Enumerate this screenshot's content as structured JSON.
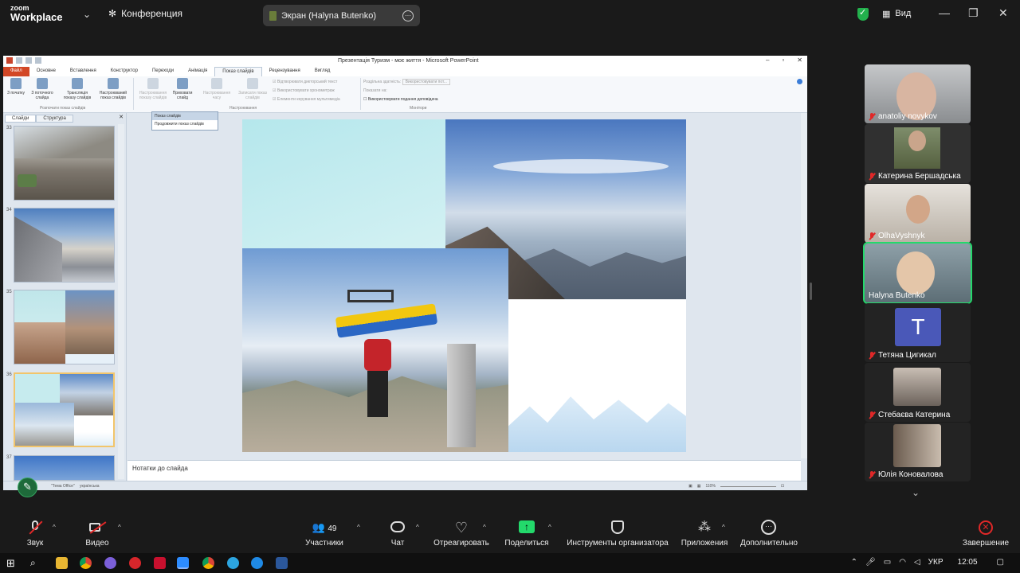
{
  "zoom": {
    "logo_small": "zoom",
    "logo_big": "Workplace",
    "meeting_label": "Конференция",
    "screen_share_label": "Экран (Halyna Butenko)",
    "view_label": "Вид"
  },
  "ppt": {
    "window_title": "Презентація Туризм - моє життя - Microsoft PowerPoint",
    "tabs": [
      "Файл",
      "Основне",
      "Вставлення",
      "Конструктор",
      "Переходи",
      "Анімація",
      "Показ слайдів",
      "Рецензування",
      "Вигляд"
    ],
    "active_tab_index": 6,
    "ribbon": {
      "from_start": "З початку",
      "from_current": "З поточного слайда",
      "broadcast": "Трансляція показу слайдів",
      "custom_show": "Настроюваний показ слайдів",
      "group_start": "Розпочати показ слайдів",
      "setup_show": "Настроювання показу слайдів",
      "hide_slide": "Приховати слайд",
      "rehearse": "Настроювання часу",
      "record": "Записати показ слайдів",
      "group_setup": "Настроювання",
      "check_narration": "Відтворювати дикторський текст",
      "check_timings": "Використовувати хронометраж",
      "check_media": "Елементи керування мультимедіа",
      "resolution_label": "Роздільна здатність:",
      "resolution_value": "Використовувати пот...",
      "show_on_label": "Показати на:",
      "presenter_view": "Використовувати подання доповідача",
      "group_monitors": "Монітори"
    },
    "pane_tabs": [
      "Слайди",
      "Структура"
    ],
    "slide_numbers": [
      "33",
      "34",
      "35",
      "36",
      "37"
    ],
    "popup_title": "Показ слайдів",
    "popup_item": "Продовжити показ слайдів",
    "notes_placeholder": "Нотатки до слайда",
    "status_theme": "\"Тема Office\"",
    "status_lang": "українська",
    "zoom_level": "110%"
  },
  "participants": [
    {
      "name": "anatoliy novykov",
      "muted": true
    },
    {
      "name": "Катерина Бершадська",
      "muted": true
    },
    {
      "name": "OlhaVyshnyk",
      "muted": true
    },
    {
      "name": "Halyna Butenko",
      "muted": false
    },
    {
      "name": "Тетяна Цигикал",
      "muted": true,
      "initial": "T"
    },
    {
      "name": "Стебаєва Катерина",
      "muted": true
    },
    {
      "name": "Юлія Коновалова",
      "muted": true
    }
  ],
  "toolbar": {
    "mute": "Звук",
    "video": "Видео",
    "participants": "Участники",
    "participants_count": "49",
    "chat": "Чат",
    "react": "Отреагировать",
    "share": "Поделиться",
    "host_tools": "Инструменты организатора",
    "apps": "Приложения",
    "more": "Дополнительно",
    "end": "Завершение"
  },
  "taskbar": {
    "lang": "УКР",
    "time": "12:05"
  },
  "colors": {
    "share_green": "#23d96b",
    "mute_red": "#e02828",
    "ppt_file_tab": "#d24726",
    "zoom_bg": "#1a1a1a"
  }
}
